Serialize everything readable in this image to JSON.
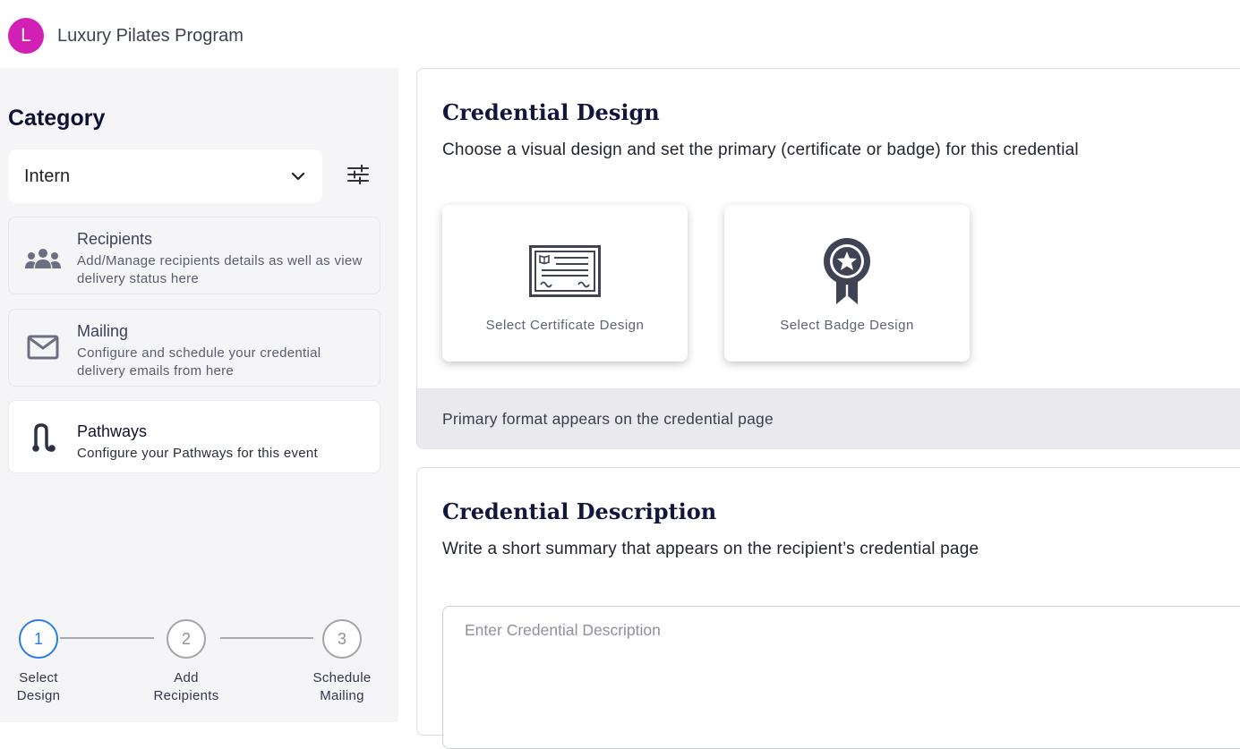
{
  "header": {
    "avatar_letter": "L",
    "title": "Luxury Pilates Program",
    "avatar_color": "#d21fb4"
  },
  "sidebar": {
    "category_title": "Category",
    "category_select": {
      "value": "Intern"
    },
    "nav": [
      {
        "title": "Recipients",
        "description": "Add/Manage recipients details as well as view delivery status here",
        "icon": "people-icon"
      },
      {
        "title": "Mailing",
        "description": "Configure and schedule your credential delivery emails from here",
        "icon": "envelope-icon"
      },
      {
        "title": "Pathways",
        "description": "Configure your Pathways for this event",
        "icon": "pathway-icon",
        "active": true
      }
    ]
  },
  "stepper": {
    "steps": [
      {
        "number": "1",
        "label_line1": "Select",
        "label_line2": "Design",
        "active": true
      },
      {
        "number": "2",
        "label_line1": "Add",
        "label_line2": "Recipients",
        "active": false
      },
      {
        "number": "3",
        "label_line1": "Schedule",
        "label_line2": "Mailing",
        "active": false
      }
    ],
    "active_color": "#2b7be4"
  },
  "credential_design": {
    "title": "Credential Design",
    "subtitle": "Choose a visual design and set the primary (certificate or badge) for this credential",
    "certificate_label": "Select Certificate Design",
    "badge_label": "Select Badge Design",
    "footer_note": "Primary format appears on the credential page"
  },
  "credential_description": {
    "title": "Credential Description",
    "subtitle": "Write a short summary that appears on the recipient’s credential page",
    "placeholder": "Enter Credential Description"
  }
}
